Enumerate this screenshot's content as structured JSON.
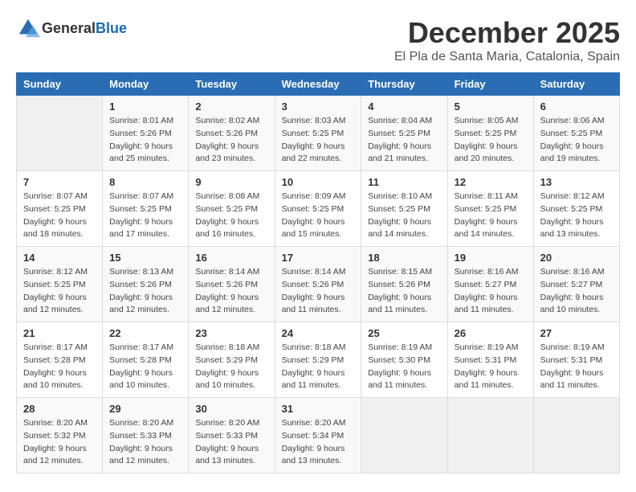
{
  "header": {
    "logo_general": "General",
    "logo_blue": "Blue",
    "month": "December 2025",
    "location": "El Pla de Santa Maria, Catalonia, Spain"
  },
  "calendar": {
    "columns": [
      "Sunday",
      "Monday",
      "Tuesday",
      "Wednesday",
      "Thursday",
      "Friday",
      "Saturday"
    ],
    "weeks": [
      [
        {
          "day": "",
          "info": ""
        },
        {
          "day": "1",
          "info": "Sunrise: 8:01 AM\nSunset: 5:26 PM\nDaylight: 9 hours\nand 25 minutes."
        },
        {
          "day": "2",
          "info": "Sunrise: 8:02 AM\nSunset: 5:26 PM\nDaylight: 9 hours\nand 23 minutes."
        },
        {
          "day": "3",
          "info": "Sunrise: 8:03 AM\nSunset: 5:25 PM\nDaylight: 9 hours\nand 22 minutes."
        },
        {
          "day": "4",
          "info": "Sunrise: 8:04 AM\nSunset: 5:25 PM\nDaylight: 9 hours\nand 21 minutes."
        },
        {
          "day": "5",
          "info": "Sunrise: 8:05 AM\nSunset: 5:25 PM\nDaylight: 9 hours\nand 20 minutes."
        },
        {
          "day": "6",
          "info": "Sunrise: 8:06 AM\nSunset: 5:25 PM\nDaylight: 9 hours\nand 19 minutes."
        }
      ],
      [
        {
          "day": "7",
          "info": "Sunrise: 8:07 AM\nSunset: 5:25 PM\nDaylight: 9 hours\nand 18 minutes."
        },
        {
          "day": "8",
          "info": "Sunrise: 8:07 AM\nSunset: 5:25 PM\nDaylight: 9 hours\nand 17 minutes."
        },
        {
          "day": "9",
          "info": "Sunrise: 8:08 AM\nSunset: 5:25 PM\nDaylight: 9 hours\nand 16 minutes."
        },
        {
          "day": "10",
          "info": "Sunrise: 8:09 AM\nSunset: 5:25 PM\nDaylight: 9 hours\nand 15 minutes."
        },
        {
          "day": "11",
          "info": "Sunrise: 8:10 AM\nSunset: 5:25 PM\nDaylight: 9 hours\nand 14 minutes."
        },
        {
          "day": "12",
          "info": "Sunrise: 8:11 AM\nSunset: 5:25 PM\nDaylight: 9 hours\nand 14 minutes."
        },
        {
          "day": "13",
          "info": "Sunrise: 8:12 AM\nSunset: 5:25 PM\nDaylight: 9 hours\nand 13 minutes."
        }
      ],
      [
        {
          "day": "14",
          "info": "Sunrise: 8:12 AM\nSunset: 5:25 PM\nDaylight: 9 hours\nand 12 minutes."
        },
        {
          "day": "15",
          "info": "Sunrise: 8:13 AM\nSunset: 5:26 PM\nDaylight: 9 hours\nand 12 minutes."
        },
        {
          "day": "16",
          "info": "Sunrise: 8:14 AM\nSunset: 5:26 PM\nDaylight: 9 hours\nand 12 minutes."
        },
        {
          "day": "17",
          "info": "Sunrise: 8:14 AM\nSunset: 5:26 PM\nDaylight: 9 hours\nand 11 minutes."
        },
        {
          "day": "18",
          "info": "Sunrise: 8:15 AM\nSunset: 5:26 PM\nDaylight: 9 hours\nand 11 minutes."
        },
        {
          "day": "19",
          "info": "Sunrise: 8:16 AM\nSunset: 5:27 PM\nDaylight: 9 hours\nand 11 minutes."
        },
        {
          "day": "20",
          "info": "Sunrise: 8:16 AM\nSunset: 5:27 PM\nDaylight: 9 hours\nand 10 minutes."
        }
      ],
      [
        {
          "day": "21",
          "info": "Sunrise: 8:17 AM\nSunset: 5:28 PM\nDaylight: 9 hours\nand 10 minutes."
        },
        {
          "day": "22",
          "info": "Sunrise: 8:17 AM\nSunset: 5:28 PM\nDaylight: 9 hours\nand 10 minutes."
        },
        {
          "day": "23",
          "info": "Sunrise: 8:18 AM\nSunset: 5:29 PM\nDaylight: 9 hours\nand 10 minutes."
        },
        {
          "day": "24",
          "info": "Sunrise: 8:18 AM\nSunset: 5:29 PM\nDaylight: 9 hours\nand 11 minutes."
        },
        {
          "day": "25",
          "info": "Sunrise: 8:19 AM\nSunset: 5:30 PM\nDaylight: 9 hours\nand 11 minutes."
        },
        {
          "day": "26",
          "info": "Sunrise: 8:19 AM\nSunset: 5:31 PM\nDaylight: 9 hours\nand 11 minutes."
        },
        {
          "day": "27",
          "info": "Sunrise: 8:19 AM\nSunset: 5:31 PM\nDaylight: 9 hours\nand 11 minutes."
        }
      ],
      [
        {
          "day": "28",
          "info": "Sunrise: 8:20 AM\nSunset: 5:32 PM\nDaylight: 9 hours\nand 12 minutes."
        },
        {
          "day": "29",
          "info": "Sunrise: 8:20 AM\nSunset: 5:33 PM\nDaylight: 9 hours\nand 12 minutes."
        },
        {
          "day": "30",
          "info": "Sunrise: 8:20 AM\nSunset: 5:33 PM\nDaylight: 9 hours\nand 13 minutes."
        },
        {
          "day": "31",
          "info": "Sunrise: 8:20 AM\nSunset: 5:34 PM\nDaylight: 9 hours\nand 13 minutes."
        },
        {
          "day": "",
          "info": ""
        },
        {
          "day": "",
          "info": ""
        },
        {
          "day": "",
          "info": ""
        }
      ]
    ]
  }
}
